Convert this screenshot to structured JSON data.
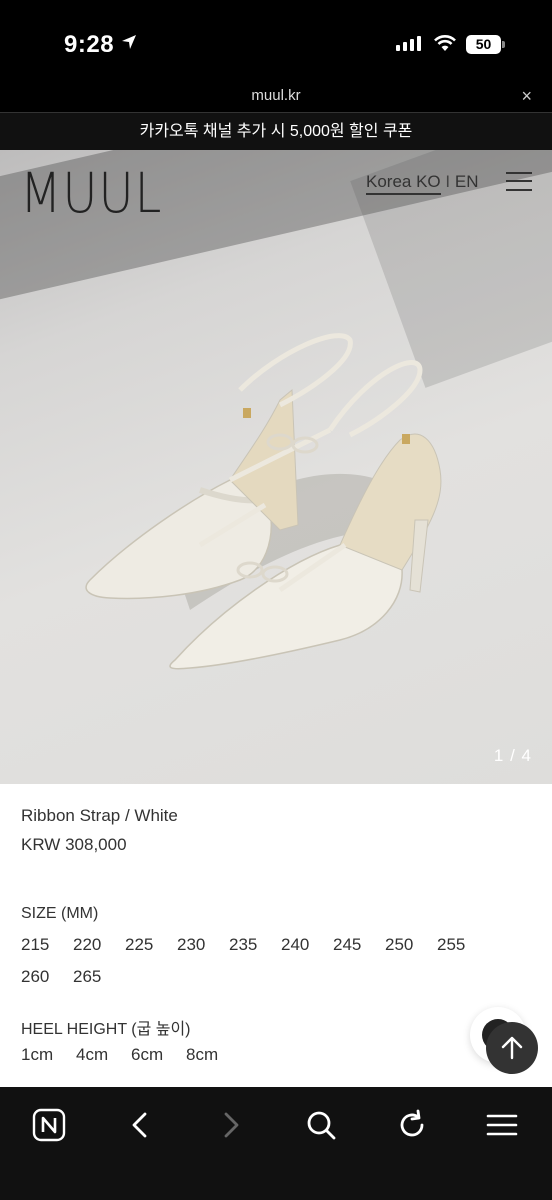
{
  "status_bar": {
    "time": "9:28",
    "battery": "50",
    "icons": [
      "location-arrow-icon",
      "cellular-signal-icon",
      "wifi-icon",
      "battery-icon"
    ]
  },
  "browser": {
    "url": "muul.kr",
    "close_icon": "×"
  },
  "promo_banner": {
    "text": "카카오톡 채널 추가 시 5,000원 할인 쿠폰"
  },
  "header": {
    "logo": "MUUL",
    "lang_ko": "Korea KO",
    "lang_sep": "I",
    "lang_en": "EN"
  },
  "gallery": {
    "counter": "1 / 4"
  },
  "product": {
    "name": "Ribbon Strap / White",
    "price": "KRW 308,000",
    "size_label": "SIZE (MM)",
    "sizes": [
      "215",
      "220",
      "225",
      "230",
      "235",
      "240",
      "245",
      "250",
      "255",
      "260",
      "265"
    ],
    "heel_label": "HEEL HEIGHT (굽 높이)",
    "heel_heights": [
      "1cm",
      "4cm",
      "6cm",
      "8cm"
    ]
  },
  "toolbar": {
    "items": [
      "naver-home-icon",
      "back-icon",
      "forward-icon",
      "search-icon",
      "refresh-icon",
      "menu-icon"
    ]
  },
  "colors": {
    "dark_bg": "#000000",
    "toolbar_bg": "#111111",
    "text": "#333333"
  }
}
